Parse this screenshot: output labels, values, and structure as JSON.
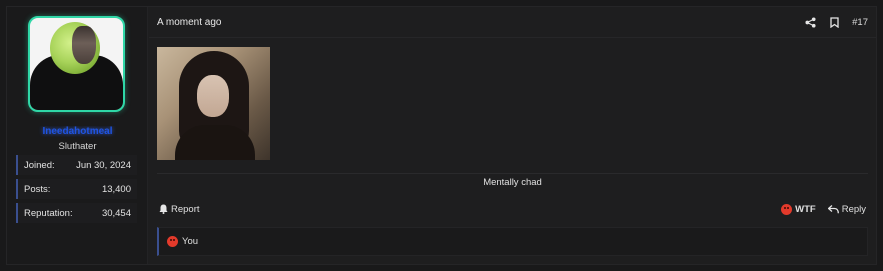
{
  "user": {
    "username": "Ineedahotmeal",
    "title": "Sluthater",
    "stats": [
      {
        "label": "Joined:",
        "value": "Jun 30, 2024"
      },
      {
        "label": "Posts:",
        "value": "13,400"
      },
      {
        "label": "Reputation:",
        "value": "30,454"
      }
    ],
    "avatar_ring_color": "#2fd7a7",
    "username_color": "#1f54e3"
  },
  "post": {
    "timestamp": "A moment ago",
    "number": "#17",
    "header_icons": [
      "share-icon",
      "bookmark-icon"
    ],
    "signature": "Mentally chad"
  },
  "footer": {
    "report_label": "Report",
    "report_icon": "bell-icon",
    "wtf_label": "WTF",
    "wtf_icon": "angry-face-icon",
    "reply_label": "Reply",
    "reply_icon": "reply-arrow-icon"
  },
  "reactions": {
    "icon": "angry-face-icon",
    "text": "You"
  }
}
